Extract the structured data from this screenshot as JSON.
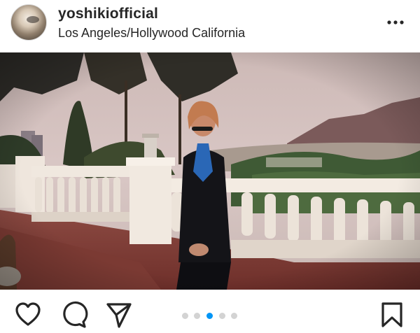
{
  "post": {
    "username": "yoshikiofficial",
    "location": "Los Angeles/Hollywood California",
    "media_count": 5,
    "active_media_index": 3
  },
  "icons": {
    "avatar": "profile-avatar",
    "more": "more-options-icon",
    "like": "heart-icon",
    "comment": "comment-bubble-icon",
    "share": "send-paper-plane-icon",
    "save": "bookmark-icon"
  },
  "colors": {
    "text": "#262626",
    "accent": "#0095f6",
    "dot_inactive": "#d3d3d3"
  }
}
